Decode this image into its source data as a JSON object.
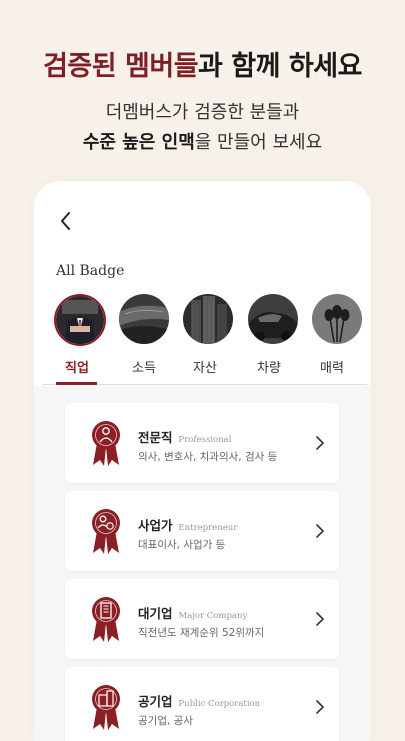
{
  "header": {
    "headline_accent": "검증된 멤버들",
    "headline_rest": "과 함께 하세요",
    "sub_line1": "더멤버스가 검증한 분들과",
    "sub_line2_bold": "수준 높은 인맥",
    "sub_line2_rest": "을 만들어 보세요"
  },
  "screen": {
    "back_icon": "chevron-left-icon",
    "section_title": "All Badge",
    "badge_photos": [
      "person-in-suit",
      "car-leather-seat",
      "city-buildings",
      "luxury-car",
      "tulips"
    ],
    "tabs": [
      "직업",
      "소득",
      "자산",
      "차량",
      "매력"
    ],
    "active_tab": "직업",
    "cards": [
      {
        "name": "전문직",
        "eng": "Professional",
        "desc": "의사, 변호사, 치과의사, 검사 등",
        "icon": "person-medal-icon"
      },
      {
        "name": "사업가",
        "eng": "Entrepreneur",
        "desc": "대표이사, 사업가 등",
        "icon": "business-medal-icon"
      },
      {
        "name": "대기업",
        "eng": "Major Company",
        "desc": "직전년도 재계순위 52위까지",
        "icon": "building-medal-icon"
      },
      {
        "name": "공기업",
        "eng": "Public Corporation",
        "desc": "공기업, 공사",
        "icon": "office-medal-icon"
      }
    ]
  },
  "colors": {
    "accent": "#7d1f24",
    "background": "#f7f1ea",
    "medal": "#8b1f26"
  }
}
